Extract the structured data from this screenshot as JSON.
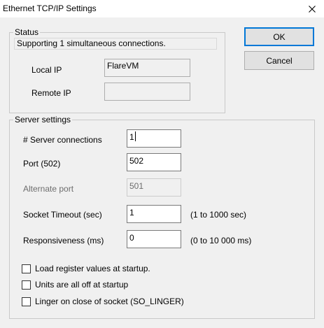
{
  "window": {
    "title": "Ethernet TCP/IP Settings"
  },
  "buttons": {
    "ok_label": "OK",
    "cancel_label": "Cancel"
  },
  "status": {
    "legend": "Status",
    "message": "Supporting 1 simultaneous connections.",
    "local_ip_label": "Local IP",
    "local_ip_value": "FlareVM",
    "remote_ip_label": "Remote IP",
    "remote_ip_value": ""
  },
  "server": {
    "legend": "Server settings",
    "connections_label": "# Server connections",
    "connections_value": "1",
    "port_label": "Port (502)",
    "port_value": "502",
    "alternate_label": "Alternate port",
    "alternate_value": "501",
    "timeout_label": "Socket Timeout (sec)",
    "timeout_value": "1",
    "timeout_hint": "(1 to 1000 sec)",
    "responsiveness_label": "Responsiveness (ms)",
    "responsiveness_value": "0",
    "responsiveness_hint": "(0 to 10 000 ms)"
  },
  "options": [
    {
      "label": "Load register values at startup.",
      "checked": false
    },
    {
      "label": "Units are all off at startup",
      "checked": false
    },
    {
      "label": "Linger on close of socket (SO_LINGER)",
      "checked": false
    }
  ]
}
